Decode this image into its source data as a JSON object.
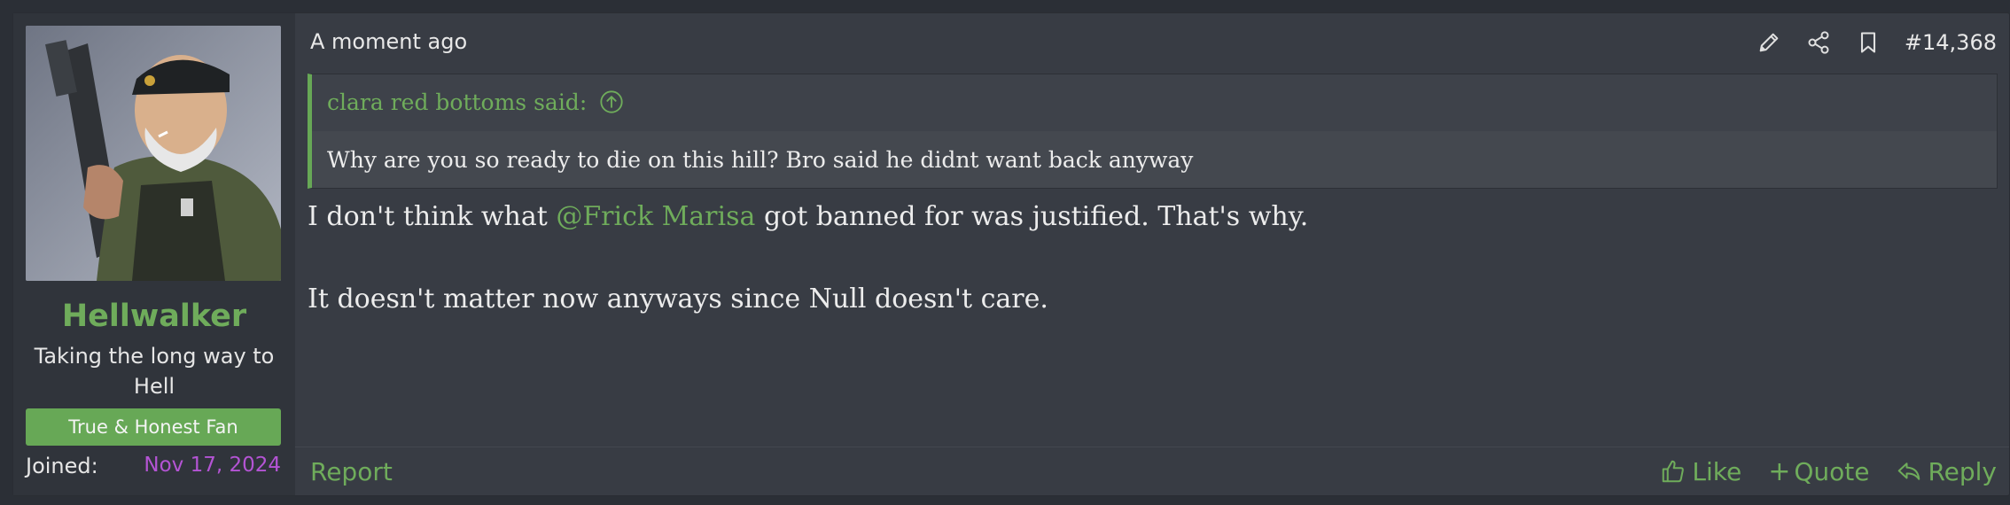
{
  "post": {
    "date": "A moment ago",
    "number": "#14,368",
    "author": {
      "name": "Hellwalker",
      "title": "Taking the long way to Hell",
      "banner": "True & Honest Fan",
      "joined_label": "Joined:",
      "joined_value": "Nov 17, 2024"
    },
    "quote": {
      "attribution": "clara red bottoms said:",
      "text": "Why are you so ready to die on this hill? Bro said he didnt want back anyway"
    },
    "body": {
      "line1_before": "I don't think what ",
      "mention": "@Frick Marisa",
      "line1_after": " got banned for was justified. That's why.",
      "line2": "It doesn't matter now anyways since Null doesn't care."
    },
    "footer": {
      "report": "Report",
      "like": "Like",
      "quote": "Quote",
      "reply": "Reply"
    },
    "icons": {
      "edit": "pencil-icon",
      "share": "share-icon",
      "bookmark": "bookmark-icon",
      "goto_quote": "circle-arrow-up-icon",
      "like": "thumbs-up-icon",
      "quote": "plus-icon",
      "reply": "reply-arrow-icon"
    },
    "colors": {
      "accent_green": "#6fac5b",
      "banner_green": "#67a856",
      "joined_purple": "#b454d4",
      "post_bg": "#383c44",
      "user_cell_bg": "#30343b"
    }
  }
}
